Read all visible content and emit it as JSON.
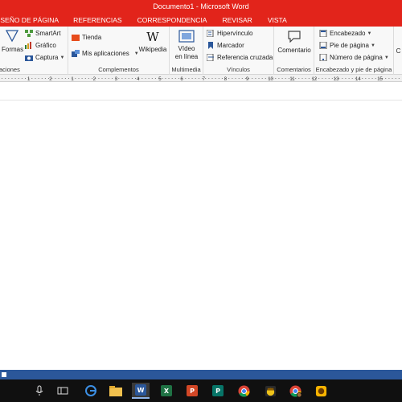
{
  "window": {
    "title": "Documento1 - Microsoft Word"
  },
  "tabs": [
    "ISEÑO DE PÁGINA",
    "REFERENCIAS",
    "CORRESPONDENCIA",
    "REVISAR",
    "VISTA"
  ],
  "ribbon": {
    "illustrations": {
      "label": "aciones",
      "formas": "Formas",
      "smartart": "SmartArt",
      "grafico": "Gráfico",
      "captura": "Captura"
    },
    "complementos": {
      "label": "Complementos",
      "tienda": "Tienda",
      "mis_aplicaciones": "Mis aplicaciones",
      "wikipedia": "Wikipedia",
      "wikipedia_glyph": "W"
    },
    "multimedia": {
      "label": "Multimedia",
      "video_line1": "Vídeo",
      "video_line2": "en línea"
    },
    "vinculos": {
      "label": "Vínculos",
      "hipervinculo": "Hipervínculo",
      "marcador": "Marcador",
      "referencia": "Referencia cruzada"
    },
    "comentarios": {
      "label": "Comentarios",
      "comentario": "Comentario"
    },
    "encabezado": {
      "label": "Encabezado y pie de página",
      "encabezado": "Encabezado",
      "pie": "Pie de página",
      "numero": "Número de página"
    },
    "overflow": {
      "letter": "C"
    }
  },
  "ruler": {
    "numbers": [
      "1",
      "2",
      "1",
      "2",
      "3",
      "4",
      "5",
      "6",
      "7",
      "8",
      "9",
      "10",
      "11",
      "12",
      "13",
      "14",
      "15"
    ]
  },
  "taskbar": {
    "word_letter": "W",
    "excel_letter": "X",
    "ppt_letter": "P",
    "publisher_letter": "P"
  },
  "colors": {
    "word_red": "#e2241b",
    "status_blue": "#2b579a",
    "taskbar": "#101010"
  }
}
